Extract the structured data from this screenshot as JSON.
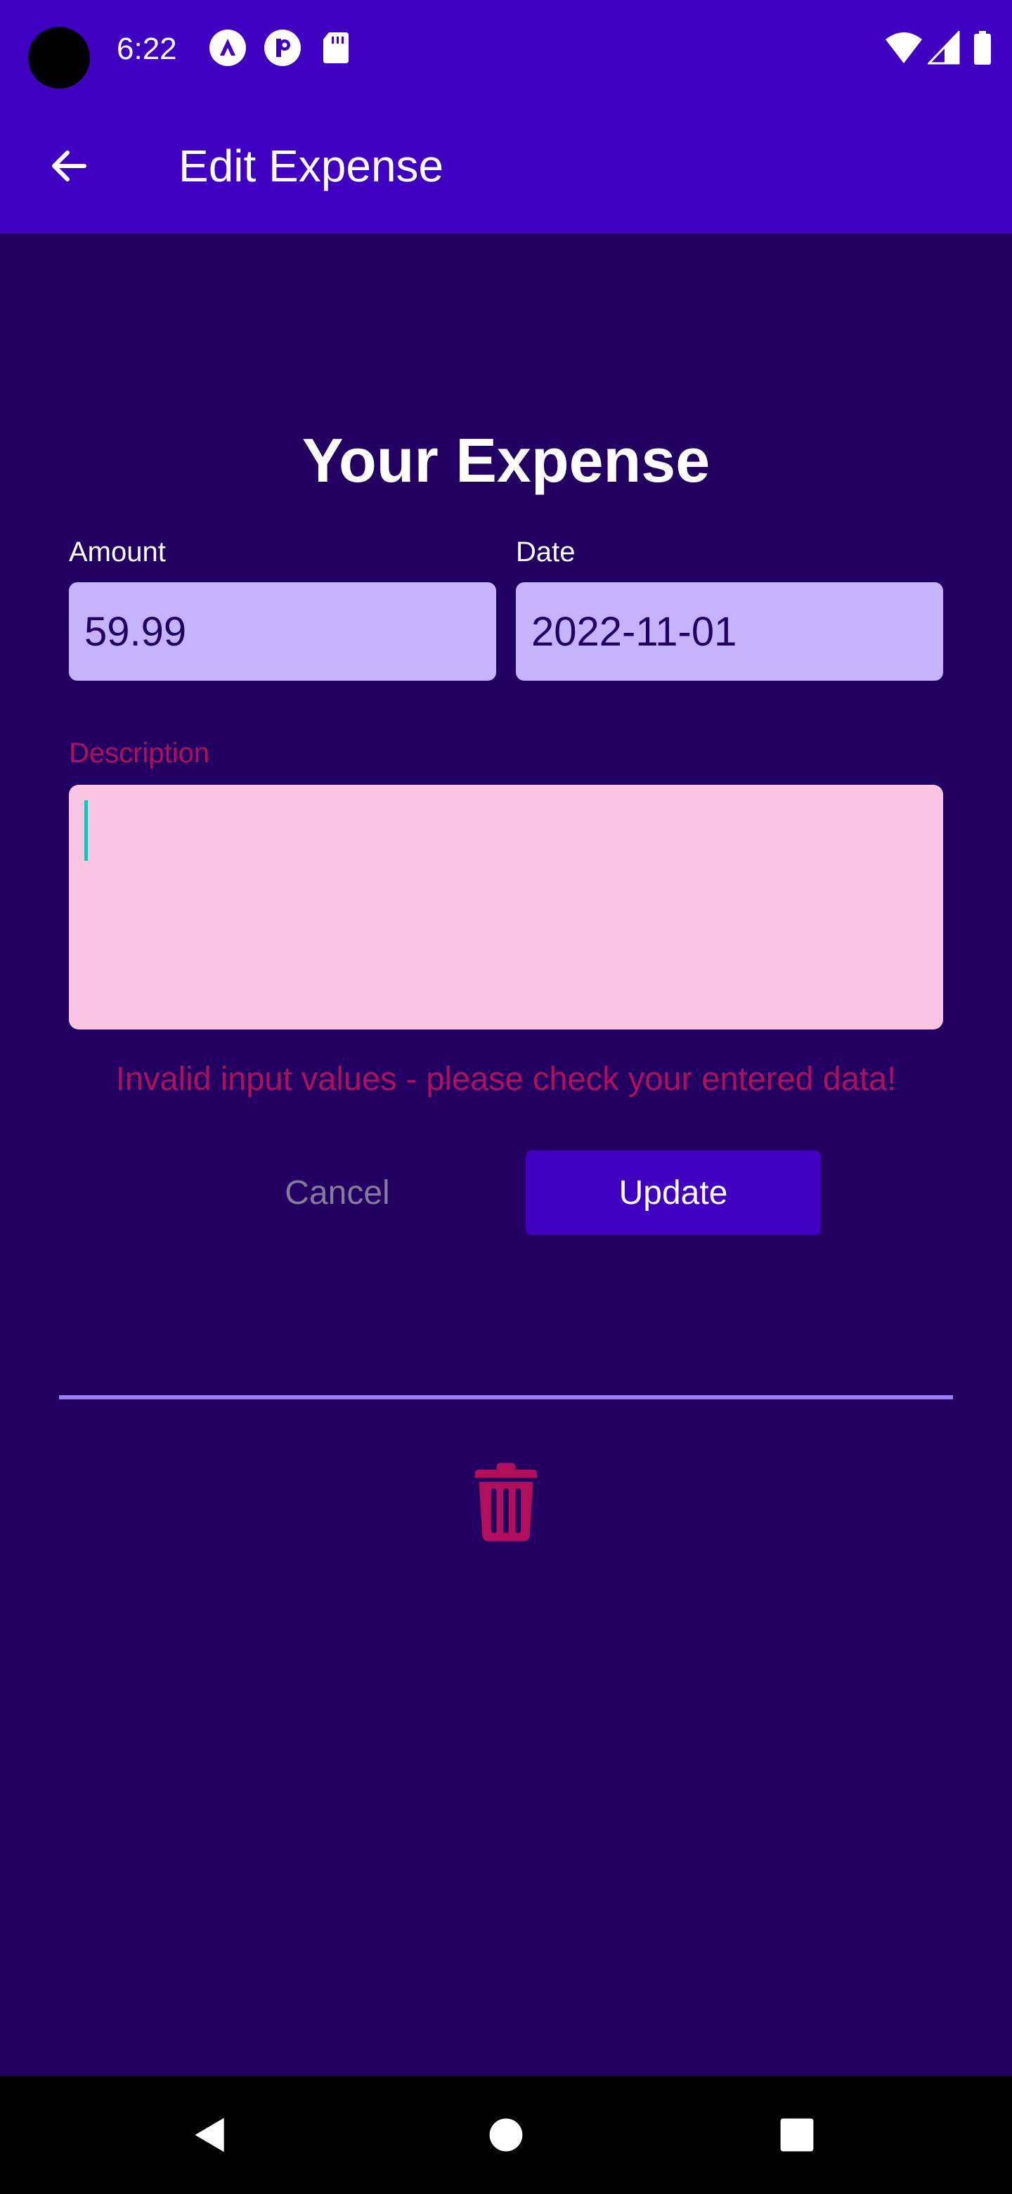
{
  "status_bar": {
    "time": "6:22",
    "icons": [
      "camera-cutout",
      "a-logo-icon",
      "p-logo-icon",
      "sd-card-icon",
      "wifi-icon",
      "signal-icon",
      "battery-icon"
    ]
  },
  "app_bar": {
    "title": "Edit Expense",
    "back_icon": "arrow-left-icon"
  },
  "form": {
    "title": "Your Expense",
    "amount": {
      "label": "Amount",
      "value": "59.99"
    },
    "date": {
      "label": "Date",
      "value": "2022-11-01"
    },
    "description": {
      "label": "Description",
      "value": ""
    },
    "error_message": "Invalid input values - please check your entered data!",
    "cancel_label": "Cancel",
    "update_label": "Update"
  },
  "delete": {
    "icon": "trash-icon"
  },
  "nav_bar": {
    "icons": [
      "back-triangle-icon",
      "home-circle-icon",
      "recents-square-icon"
    ]
  },
  "colors": {
    "primary": "#3f00c2",
    "background": "#220062",
    "input_bg": "#c7b3fb",
    "error": "#b10e5c",
    "error_input_bg": "#fac4e2",
    "divider": "#9d7ef2",
    "cursor": "#19c2b1"
  }
}
